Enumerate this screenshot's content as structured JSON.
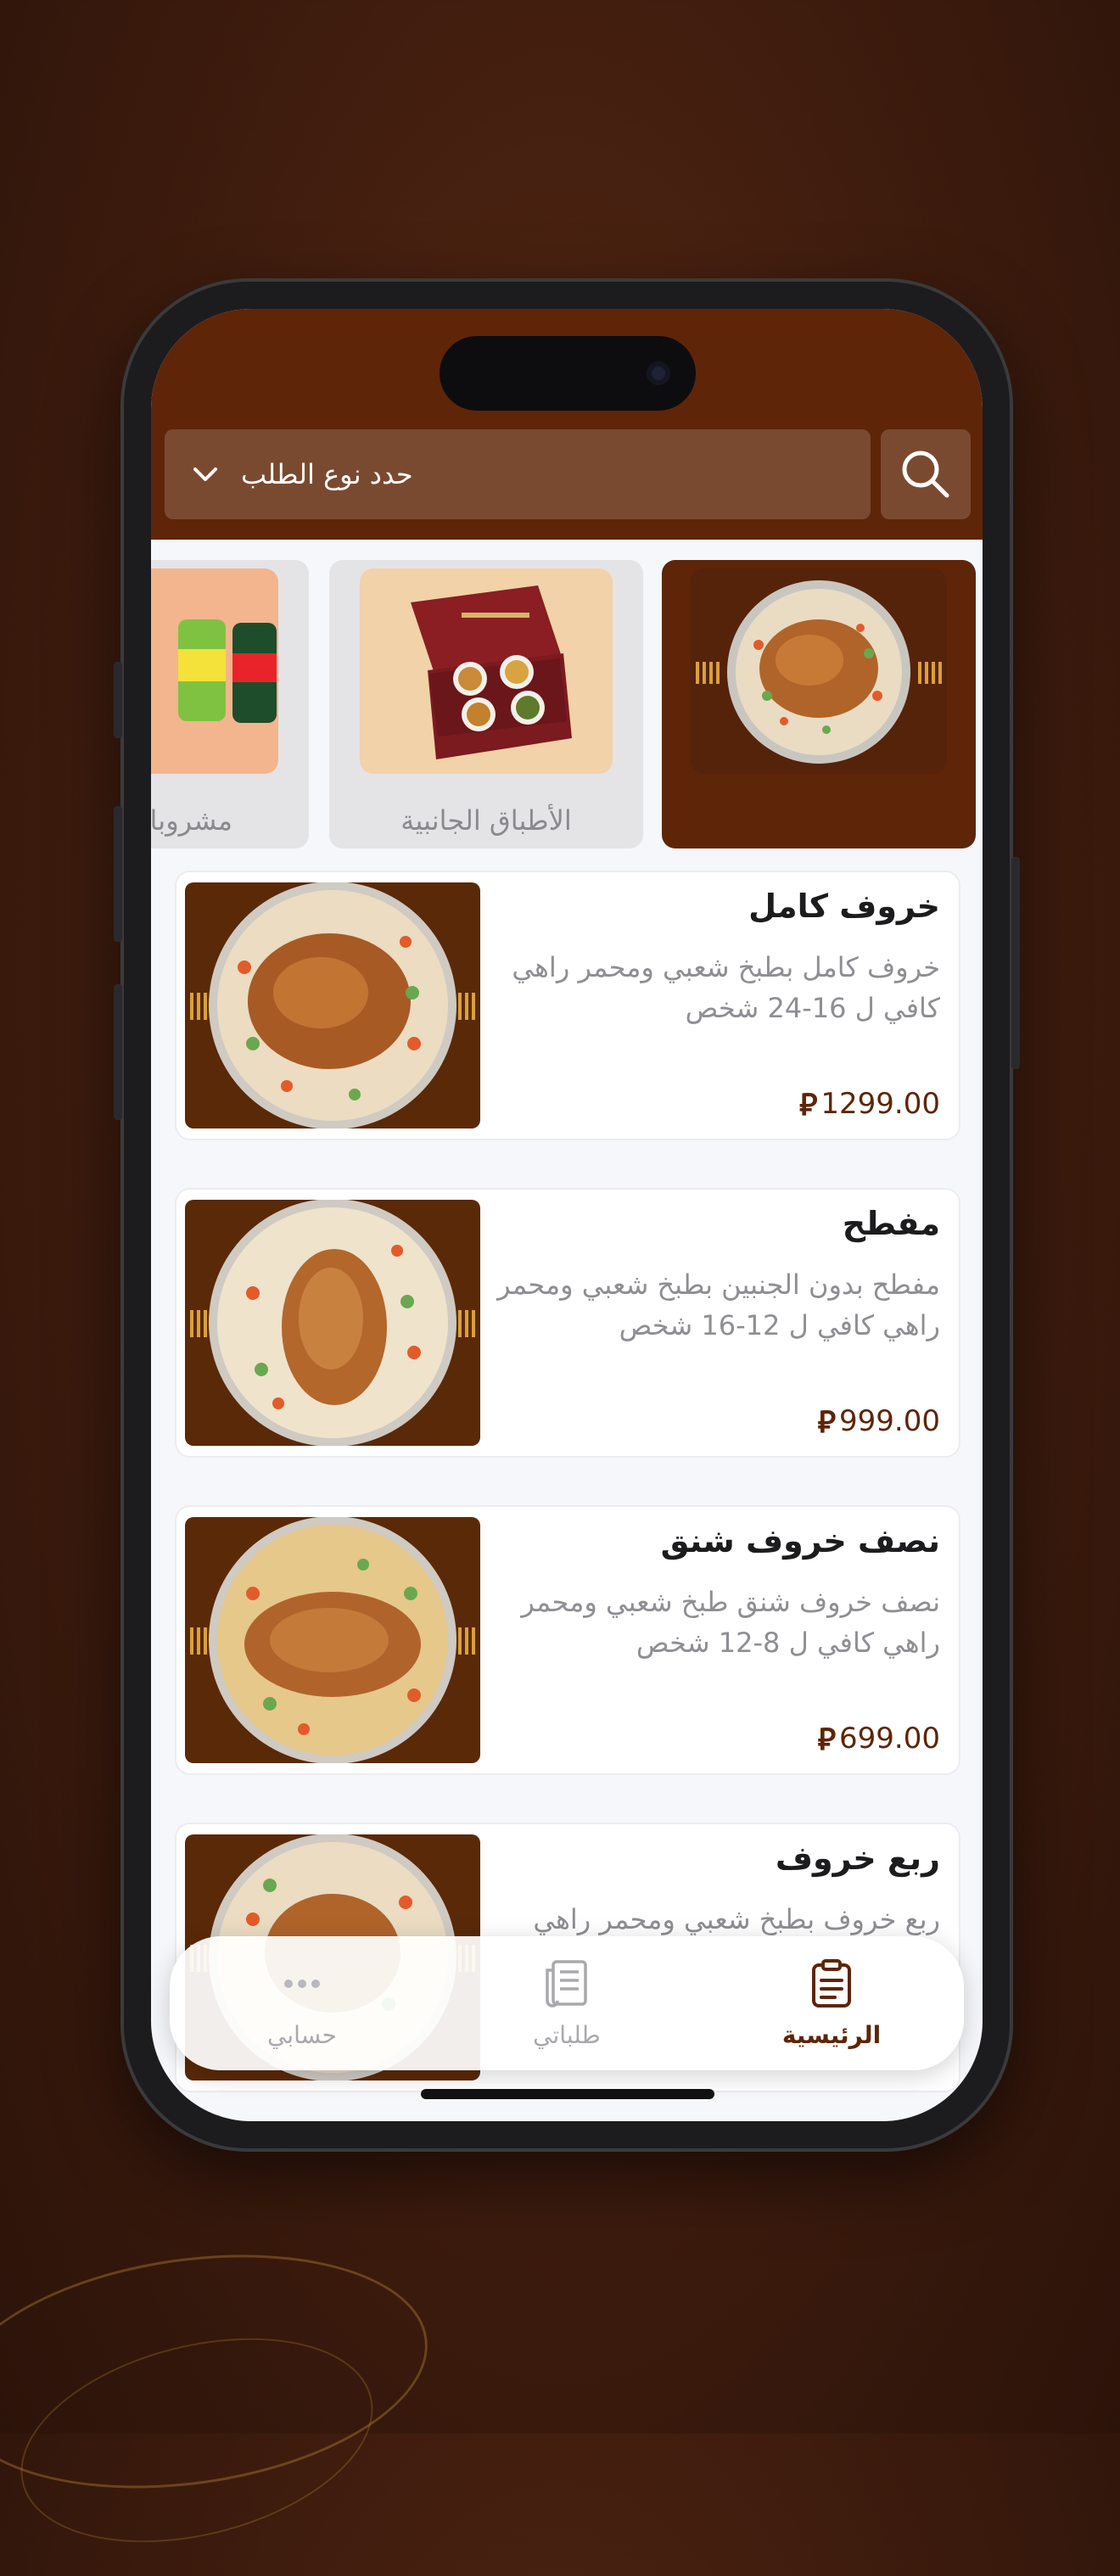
{
  "header": {
    "order_type_placeholder": "حدد نوع الطلب"
  },
  "categories": [
    {
      "label": "",
      "active": true
    },
    {
      "label": "الأطباق الجانبية",
      "active": false
    },
    {
      "label": "مشروبات",
      "active": false
    }
  ],
  "products": [
    {
      "title": "خروف كامل",
      "description": "خروف كامل بطبخ شعبي ومحمر راهي كافي ل 16-24 شخص",
      "price": "1299.00"
    },
    {
      "title": "مفطح",
      "description": "مفطح بدون الجنبين بطبخ شعبي ومحمر راهي كافي ل 12-16 شخص",
      "price": "999.00"
    },
    {
      "title": "نصف خروف شنق",
      "description": "نصف خروف شنق طبخ شعبي ومحمر راهي كافي ل 8-12 شخص",
      "price": "699.00"
    },
    {
      "title": "ربع خروف",
      "description": "ربع خروف بطبخ شعبي ومحمر راهي",
      "price": ""
    }
  ],
  "currency_symbol": "⃁",
  "tabbar": {
    "home": "الرئيسية",
    "orders": "طلباتي",
    "account": "حسابي"
  },
  "colors": {
    "brand": "#5e2508",
    "header_field": "#7a4a30",
    "background": "#f6f7fb"
  }
}
